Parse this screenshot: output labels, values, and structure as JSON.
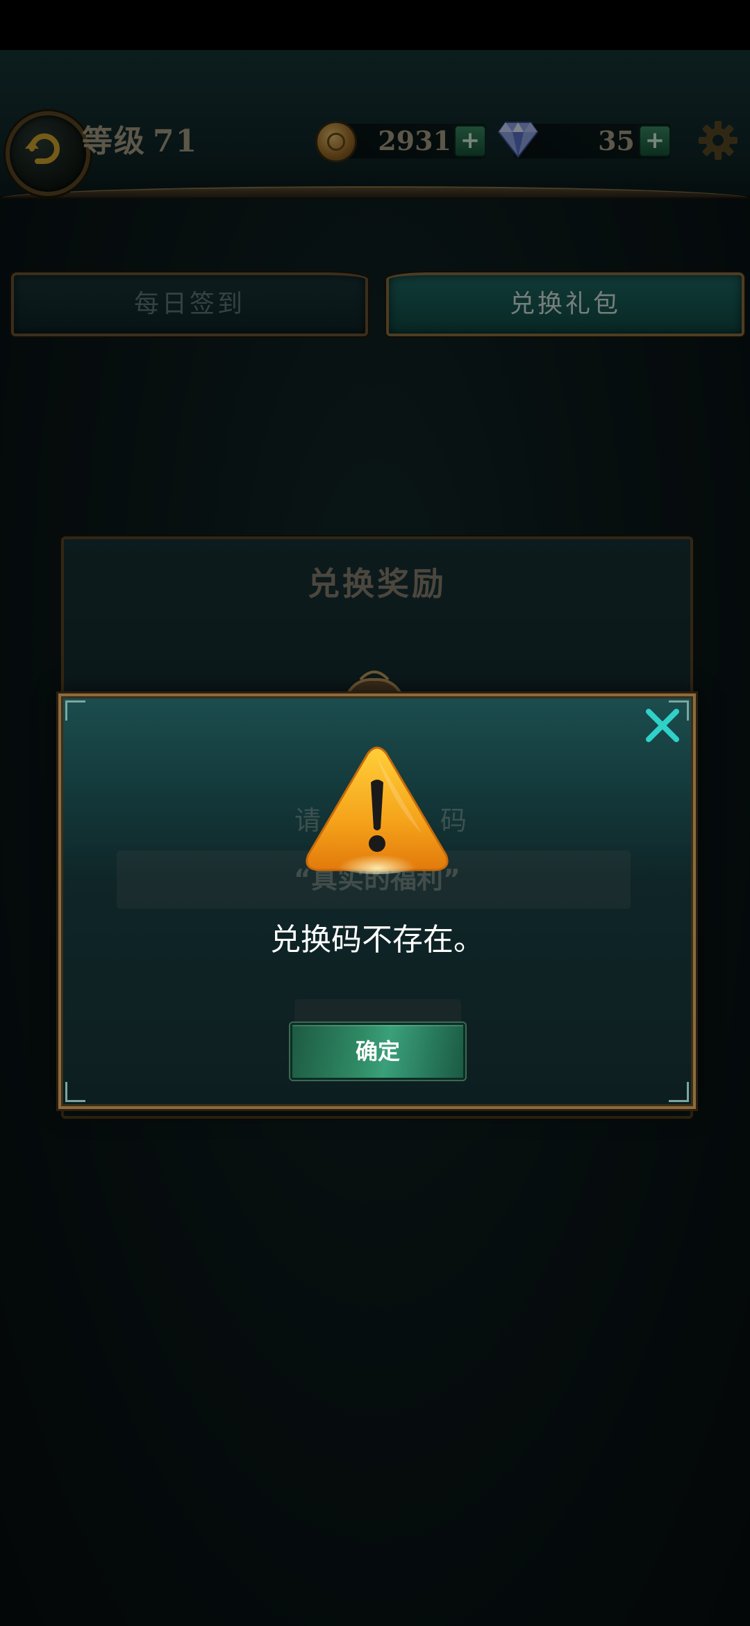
{
  "header": {
    "level_label": "等级",
    "level_value": "71",
    "gold": "2931",
    "gems": "35",
    "plus_symbol": "+"
  },
  "tabs": [
    {
      "label": "每日签到",
      "active": false
    },
    {
      "label": "兑换礼包",
      "active": true
    }
  ],
  "background_panel": {
    "title": "兑换奖励",
    "prompt_partial": "请",
    "prompt_partial_2": "码",
    "hint_text": "“真实的福利”",
    "button_partial": "确定"
  },
  "dialog": {
    "message": "兑换码不存在。",
    "confirm_label": "确定"
  },
  "colors": {
    "accent_teal": "#2fd1c8",
    "frame_gold": "#8e6b3c",
    "confirm_green": "#2f8a64",
    "warning_orange": "#f5a31a"
  },
  "icons": {
    "back": "back-arrow-icon",
    "coin": "coin-icon",
    "gem": "gem-icon",
    "settings": "gear-icon",
    "close": "close-icon",
    "warning": "warning-icon"
  }
}
